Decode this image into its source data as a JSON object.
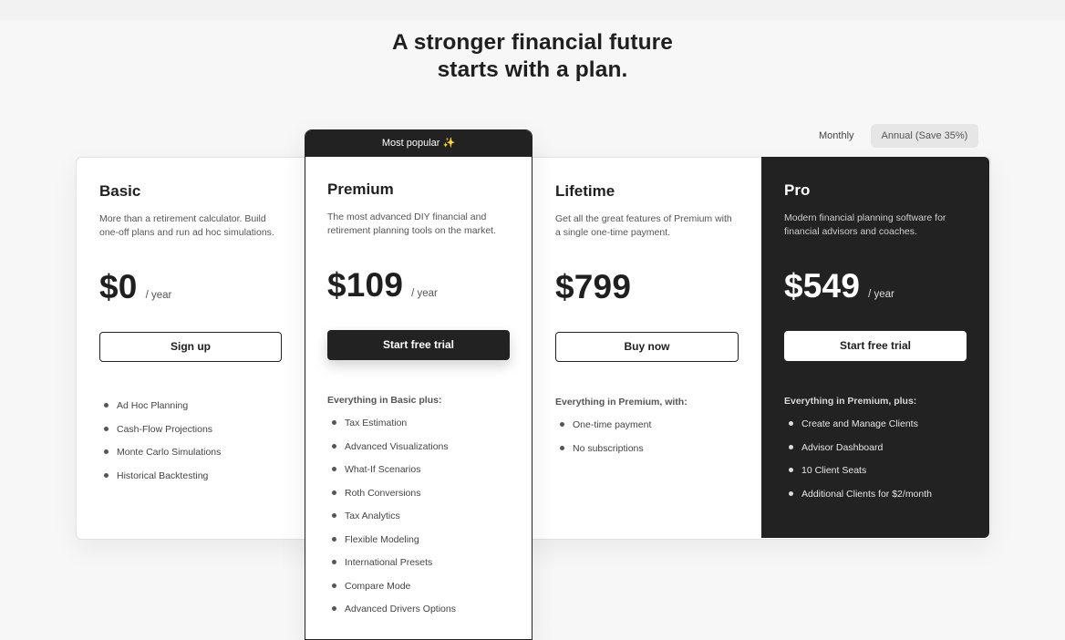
{
  "headline": {
    "line1": "A stronger financial future",
    "line2": "starts with a plan."
  },
  "billing": {
    "monthly_label": "Monthly",
    "annual_label": "Annual (Save 35%)",
    "selected": "annual"
  },
  "plans": {
    "basic": {
      "name": "Basic",
      "description": "More than a retirement calculator. Build one-off plans and run ad hoc simulations.",
      "price": "$0",
      "period": "/ year",
      "cta": "Sign up",
      "features": [
        "Ad Hoc Planning",
        "Cash-Flow Projections",
        "Monte Carlo Simulations",
        "Historical Backtesting"
      ]
    },
    "premium": {
      "badge": "Most popular ✨",
      "name": "Premium",
      "description": "The most advanced DIY financial and retirement planning tools on the market.",
      "price": "$109",
      "period": "/ year",
      "cta": "Start free trial",
      "features_heading": "Everything in Basic plus:",
      "features": [
        "Tax Estimation",
        "Advanced Visualizations",
        "What-If Scenarios",
        "Roth Conversions",
        "Tax Analytics",
        "Flexible Modeling",
        "International Presets",
        "Compare Mode",
        "Advanced Drivers Options"
      ]
    },
    "lifetime": {
      "name": "Lifetime",
      "description": "Get all the great features of Premium with a single one-time payment.",
      "price": "$799",
      "cta": "Buy now",
      "features_heading": "Everything in Premium, with:",
      "features": [
        "One-time payment",
        "No subscriptions"
      ]
    },
    "pro": {
      "name": "Pro",
      "description": "Modern financial planning software for financial advisors and coaches.",
      "price": "$549",
      "period": "/ year",
      "cta": "Start free trial",
      "features_heading": "Everything in Premium, plus:",
      "features": [
        "Create and Manage Clients",
        "Advisor Dashboard",
        "10 Client Seats",
        "Additional Clients for $2/month"
      ]
    }
  },
  "colors": {
    "dark": "#222222",
    "page_bg": "#f7f7f7",
    "card_bg": "#ffffff",
    "muted_text": "#555555"
  }
}
